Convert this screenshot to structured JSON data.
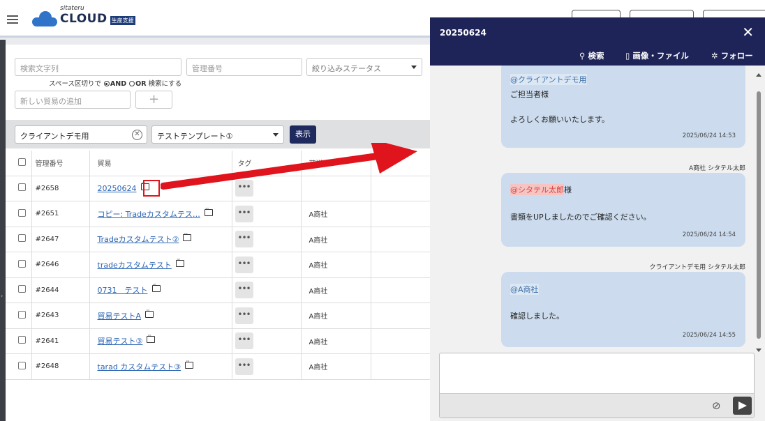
{
  "header": {
    "logo_small": "sitateru",
    "logo_main": "CLOUD",
    "logo_badge": "生産支援"
  },
  "search": {
    "keyword_placeholder": "検索文字列",
    "number_placeholder": "管理番号",
    "status_placeholder": "絞り込みステータス",
    "hint_prefix": "スペース区切りで",
    "hint_and": "AND",
    "hint_or": "OR",
    "hint_suffix": "検索にする",
    "new_trade_placeholder": "新しい貿易の追加",
    "add_symbol": "+"
  },
  "filter": {
    "client": "クライアントデモ用",
    "template": "テストテンプレート①",
    "show_button": "表示"
  },
  "table": {
    "headers": {
      "number": "管理番号",
      "trade": "貿易",
      "tag": "タグ",
      "shipper": "荷送人"
    },
    "rows": [
      {
        "id": "#2658",
        "trade": "20250624",
        "shipper": ""
      },
      {
        "id": "#2651",
        "trade": "コピー: Tradeカスタムテス…",
        "shipper": "A商社"
      },
      {
        "id": "#2647",
        "trade": "Tradeカスタムテスト②",
        "shipper": "A商社"
      },
      {
        "id": "#2646",
        "trade": "tradeカスタムテスト",
        "shipper": "A商社"
      },
      {
        "id": "#2644",
        "trade": "0731　テスト",
        "shipper": "A商社"
      },
      {
        "id": "#2643",
        "trade": "貿易テストA",
        "shipper": "A商社"
      },
      {
        "id": "#2641",
        "trade": "貿易テスト③",
        "shipper": "A商社"
      },
      {
        "id": "#2648",
        "trade": "tarad カスタムテスト③",
        "shipper": "A商社"
      }
    ],
    "more_symbol": "•••"
  },
  "chat": {
    "title": "20250624",
    "close_symbol": "✕",
    "tools": {
      "search": "検索",
      "files": "画像・ファイル",
      "follow": "フォロー"
    },
    "messages": [
      {
        "sender": "",
        "mention": "@クライアントデモ用",
        "suffix": "",
        "line1": "ご担当者様",
        "line2": "よろしくお願いいたします。",
        "time": "2025/06/24 14:53"
      },
      {
        "sender": "A商社 シタテル太郎",
        "mention": "@シタテル太郎",
        "suffix": "様",
        "line1": "",
        "line2": "書類をUPしましたのでご確認ください。",
        "time": "2025/06/24 14:54"
      },
      {
        "sender": "クライアントデモ用 シタテル太郎",
        "mention": "@A商社",
        "suffix": "",
        "line1": "",
        "line2": "確認しました。",
        "time": "2025/06/24 14:55"
      }
    ]
  },
  "colors": {
    "header_navy": "#1f2458",
    "bubble": "#ccdcee",
    "link": "#2a64b4",
    "annotation_red": "#e0141c"
  }
}
